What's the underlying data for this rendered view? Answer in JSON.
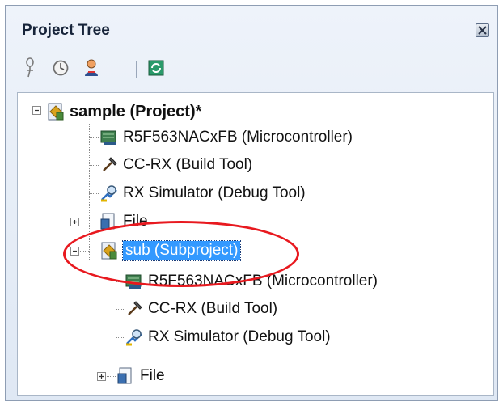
{
  "panel": {
    "title": "Project Tree"
  },
  "toolbar": {
    "icons": [
      "pin-icon",
      "clock-icon",
      "user-icon",
      "refresh-icon"
    ]
  },
  "tree": {
    "project": "sample (Project)*",
    "project_children": [
      "R5F563NACxFB (Microcontroller)",
      "CC-RX (Build Tool)",
      "RX Simulator (Debug Tool)",
      "File"
    ],
    "subproject": "sub (Subproject)",
    "sub_children": [
      "R5F563NACxFB (Microcontroller)",
      "CC-RX (Build Tool)",
      "RX Simulator (Debug Tool)",
      "File"
    ]
  },
  "colors": {
    "selection": "#3399ff",
    "annotation": "#e8191f"
  }
}
